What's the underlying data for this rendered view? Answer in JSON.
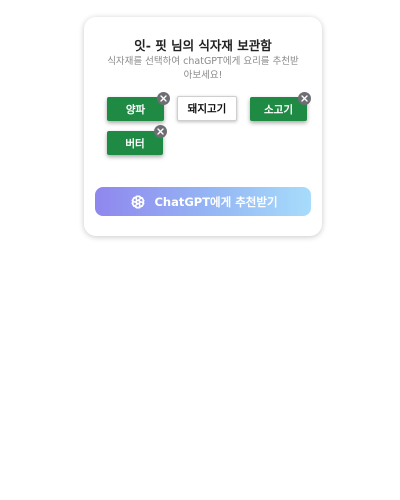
{
  "card": {
    "title": "잇- 핏 님의 식자재 보관함",
    "subtitle": "식자재를 선택하여 chatGPT에게 요리를 추천받아보세요!"
  },
  "ingredients": [
    {
      "label": "양파",
      "selected": true
    },
    {
      "label": "돼지고기",
      "selected": false
    },
    {
      "label": "소고기",
      "selected": true
    },
    {
      "label": "버터",
      "selected": true
    }
  ],
  "remove_icon_label": "×",
  "cta": {
    "label": "ChatGPT에게 추천받기",
    "icon": "openai-logo-icon"
  },
  "colors": {
    "selected_chip": "#1f8a44",
    "remove_badge": "#6d6e73",
    "cta_gradient_start": "#8f87ee",
    "cta_gradient_end": "#a7dcfb"
  }
}
